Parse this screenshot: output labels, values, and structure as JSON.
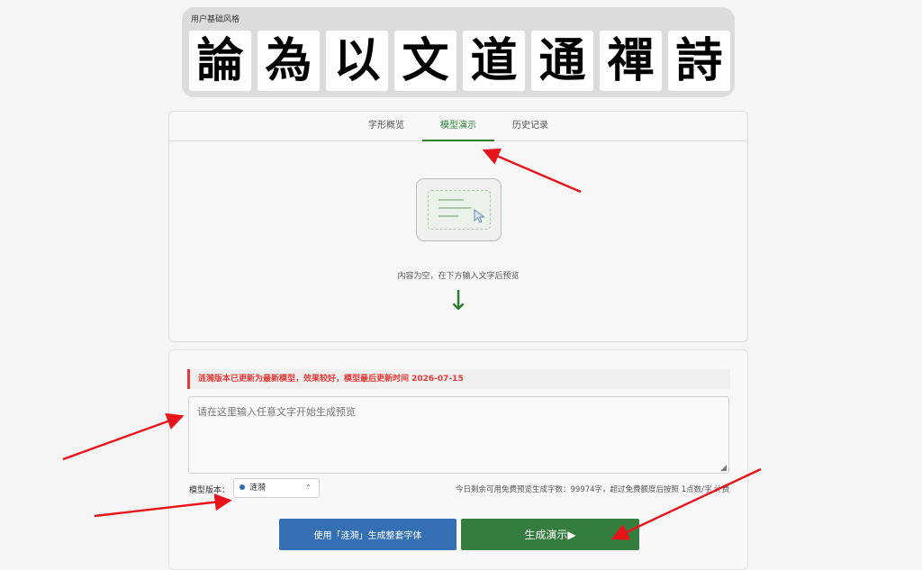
{
  "style_strip": {
    "label": "用户基础风格",
    "glyphs": [
      "論",
      "為",
      "以",
      "文",
      "道",
      "通",
      "禪",
      "詩"
    ]
  },
  "tabs": [
    {
      "label": "字形概览",
      "active": false
    },
    {
      "label": "模型演示",
      "active": true
    },
    {
      "label": "历史记录",
      "active": false
    }
  ],
  "preview": {
    "empty_text": "内容为空，在下方输入文字后预览",
    "down_arrow": "↓",
    "empty_icon": "document-cursor-icon"
  },
  "notice": {
    "text": "涟漪版本已更新为最新模型，效果较好，模型最后更新时间 2026-07-15",
    "color": "#e53935"
  },
  "text_input": {
    "placeholder": "请在这里输入任意文字开始生成预览",
    "value": ""
  },
  "model": {
    "label": "模型版本：",
    "selected": "涟漪",
    "chevron": "⌃"
  },
  "quota": {
    "text": "今日剩余可用免费预览生成字数：99974字，超过免费额度后按照 1点数/字 计费"
  },
  "buttons": {
    "full_font": "使用「涟漪」生成整套字体",
    "demo": "生成演示▶"
  },
  "colors": {
    "accent_green": "#2e7d32",
    "button_blue": "#3470b3",
    "button_green": "#357d3f",
    "annotation_red": "#e8141b"
  }
}
